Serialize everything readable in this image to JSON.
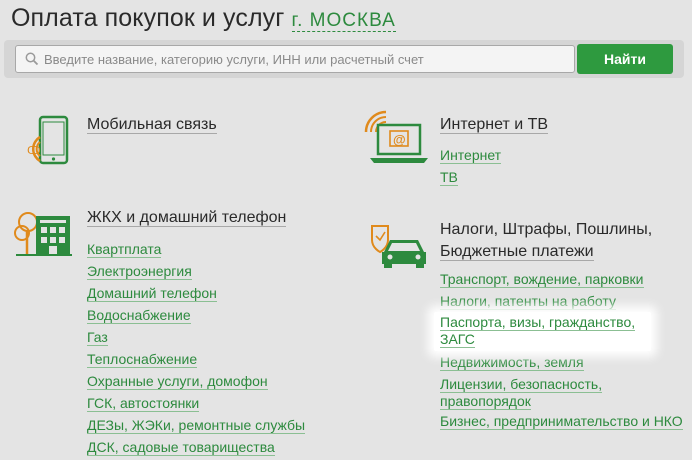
{
  "header": {
    "title": "Оплата покупок и услуг",
    "city": "г. МОСКВА"
  },
  "search": {
    "placeholder": "Введите название, категорию услуги, ИНН или расчетный счет",
    "value": "",
    "button_label": "Найти"
  },
  "categories": [
    {
      "title": "Мобильная связь",
      "icon": "mobile-phone-icon",
      "links": []
    },
    {
      "title": "Интернет и ТВ",
      "icon": "laptop-wifi-icon",
      "links": [
        "Интернет",
        "ТВ"
      ]
    },
    {
      "title": "ЖКХ и домашний телефон",
      "icon": "house-tree-icon",
      "links": [
        "Квартплата",
        "Электроэнергия",
        "Домашний телефон",
        "Водоснабжение",
        "Газ",
        "Теплоснабжение",
        "Охранные услуги, домофон",
        "ГСК, автостоянки",
        "ДЕЗы, ЖЭКи, ремонтные службы",
        "ДСК, садовые товарищества"
      ]
    },
    {
      "title_line1": "Налоги, Штрафы, Пошлины,",
      "title_line2": "Бюджетные платежи",
      "icon": "car-shield-icon",
      "links": [
        "Транспорт, вождение, парковки",
        "Налоги, патенты на работу",
        "Паспорта, визы, гражданство, ЗАГС",
        "Недвижимость, земля",
        "Лицензии, безопасность, правопорядок",
        "Бизнес, предпринимательство и НКО"
      ]
    }
  ],
  "colors": {
    "accent": "#2d8a3e",
    "button": "#2e9a3f",
    "icon_orange": "#e08a1c",
    "background": "#e4e4e4"
  }
}
